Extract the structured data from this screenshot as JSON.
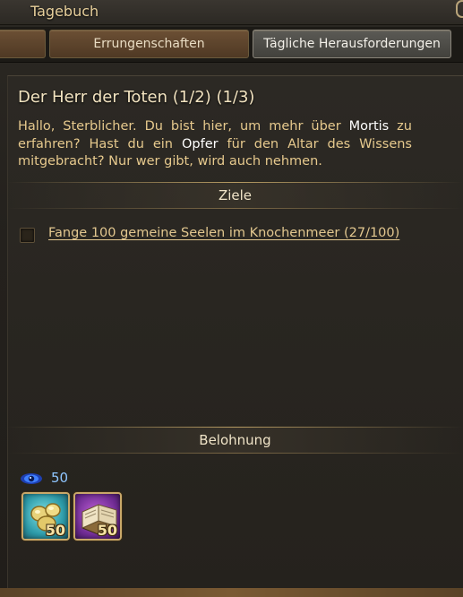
{
  "window": {
    "title": "Tagebuch"
  },
  "tabs": [
    {
      "label": ""
    },
    {
      "label": "Errungenschaften"
    },
    {
      "label": "Tägliche Herausforderungen"
    }
  ],
  "quest": {
    "title": "Der Herr der Toten (1/2) (1/3)",
    "description": {
      "part1": "Hallo, Sterblicher. Du bist hier, um mehr über ",
      "highlight1": "Mortis",
      "part2": " zu erfahren? Hast du ein ",
      "highlight2": "Opfer",
      "part3": " für den Altar des Wissens mitgebracht? Nur wer gibt, wird auch nehmen."
    }
  },
  "goals": {
    "header": "Ziele",
    "items": [
      {
        "text": "Fange 100 gemeine Seelen im Knochenmeer (27/100)",
        "checked": false
      }
    ]
  },
  "reward": {
    "header": "Belohnung",
    "xp": {
      "icon": "eye-icon",
      "value": "50"
    },
    "items": [
      {
        "icon": "gold-nuggets-icon",
        "quantity": "50"
      },
      {
        "icon": "book-icon",
        "quantity": "50"
      }
    ]
  }
}
